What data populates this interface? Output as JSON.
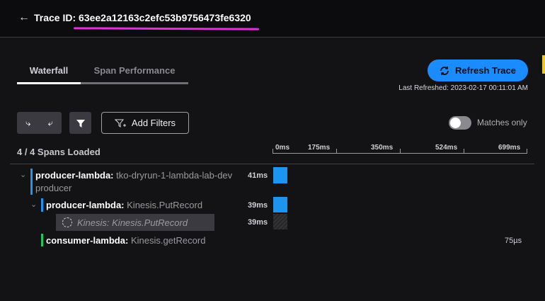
{
  "header": {
    "back_icon": "arrow-left-icon",
    "title": "Trace ID: 63ee2a12163c2efc53b9756473fe6320"
  },
  "tabs": [
    {
      "label": "Waterfall",
      "active": true
    },
    {
      "label": "Span Performance",
      "active": false
    }
  ],
  "refresh": {
    "label": "Refresh Trace",
    "last_refreshed": "Last Refreshed: 2023-02-17 00:11:01 AM"
  },
  "toolbar": {
    "add_filters": "Add Filters",
    "matches_only": "Matches only",
    "matches_only_on": false
  },
  "spans_loaded": "4 / 4 Spans Loaded",
  "timeline": {
    "ticks": [
      "0ms",
      "175ms",
      "350ms",
      "524ms",
      "699ms"
    ]
  },
  "colors": {
    "accent": "#1a8cff",
    "producer": "#1d95f0",
    "consumer": "#22c55e",
    "highlight": "#e52ee0"
  },
  "spans": [
    {
      "service": "producer-lambda:",
      "operation": "tko-dryrun-1-lambda-lab-dev",
      "operation2": "producer",
      "duration": "41ms"
    },
    {
      "service": "producer-lambda:",
      "operation": "Kinesis.PutRecord",
      "duration": "39ms"
    },
    {
      "label": "Kinesis: Kinesis.PutRecord",
      "duration": "39ms"
    },
    {
      "service": "consumer-lambda:",
      "operation": "Kinesis.getRecord",
      "duration": "75µs"
    }
  ]
}
